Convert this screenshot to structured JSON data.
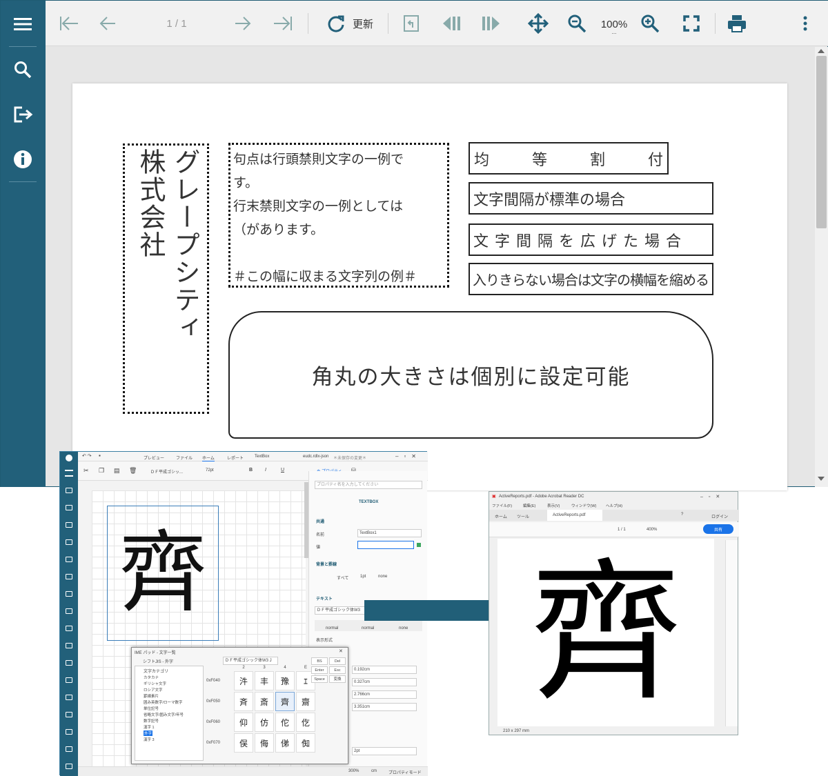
{
  "viewer": {
    "toolbar": {
      "page_indicator": "1 / 1",
      "refresh_label": "更新",
      "zoom_level": "100%",
      "zoom_sub": "..."
    },
    "report": {
      "vertical_text_col1": "グレープシティ",
      "vertical_text_col2": "株式会社",
      "kinsoku_lines": [
        "句点は行頭禁則文字の一例で",
        "す。",
        "行末禁則文字の一例としては",
        "（があります。",
        "",
        "＃この幅に収まる文字列の例＃"
      ],
      "justify_chars": [
        "均",
        "等",
        "割",
        "付"
      ],
      "spacing_normal": "文字間隔が標準の場合",
      "spacing_wide": "文字間隔を広げた場合",
      "shrink": "入りきらない場合は文字の横幅を縮める",
      "rounded": "角丸の大きさは個別に設定可能"
    }
  },
  "designer": {
    "tabs": [
      "プレビュー",
      "ファイル",
      "ホーム",
      "レポート",
      "TextBox"
    ],
    "file_title": "eudc.rdlx-json",
    "unsaved": "＊未保存の変更＊",
    "font_select": "ＤＦ平成ゴシッ...",
    "font_size": "72pt",
    "format_buttons": [
      "B",
      "I",
      "U"
    ],
    "props_tab": "プロパティ",
    "props_search_placeholder": "プロパティ名を入力してください",
    "section_textbox": "TEXTBOX",
    "section_common": "共通",
    "name_label": "名前",
    "name_value": "TextBox1",
    "value_label": "値",
    "value_value": "",
    "section_bg": "背景と罫線",
    "border_labels": [
      "すべて",
      "1pt",
      "none"
    ],
    "section_text": "テキスト",
    "text_font": "ＤＦ平成ゴシック体W3",
    "text_style_labels": [
      "normal",
      "normal",
      "none"
    ],
    "display_format_label": "表示形式",
    "measures": [
      "0.192cm",
      "0.327cm",
      "2.766cm",
      "3.351cm"
    ],
    "border_width": "2pt",
    "canvas_glyph": "齊",
    "status": {
      "zoom": "300%",
      "unit": "cm",
      "mode": "プロパティモード"
    },
    "ime": {
      "title": "IME パッド - 文字一覧",
      "charset": "シフトJIS - 外字",
      "font": "ＤＦ平成ゴシック体W3 J",
      "category_header": "文字カテゴリ",
      "categories": [
        "カタカナ",
        "ギリシャ文字",
        "ロシア文字",
        "罫線素片",
        "囲み英数字/ローマ数字",
        "単位記号",
        "省略文字/囲み文字/年号",
        "数字記号",
        "漢字 1",
        "外字",
        "漢字 3"
      ],
      "column_heads": [
        "2",
        "3",
        "4",
        "E"
      ],
      "row_codes": [
        "0xF040",
        "0xF050",
        "0xF060",
        "0xF070"
      ],
      "grid": [
        [
          "汼",
          "丰",
          "豫",
          "ｴ"
        ],
        [
          "斉",
          "斎",
          "齊",
          "齋"
        ],
        [
          "仰",
          "仿",
          "佗",
          "仡"
        ],
        [
          "俣",
          "侮",
          "俤",
          "倁"
        ]
      ],
      "keys": [
        "BS",
        "Del",
        "Enter",
        "Esc",
        "Space",
        "変換"
      ],
      "side_tabs": [
        "部",
        "画",
        "部"
      ]
    }
  },
  "acrobat": {
    "title": "ActiveReports.pdf - Adobe Acrobat Reader DC",
    "menu": [
      "ファイル(F)",
      "編集(E)",
      "表示(V)",
      "ウィンドウ(W)",
      "ヘルプ(H)"
    ],
    "tabs": [
      "ホーム",
      "ツール"
    ],
    "doc_tab": "ActiveReports.pdf",
    "login": "ログイン",
    "page": "1 / 1",
    "zoom": "400%",
    "share": "共有",
    "page_size": "210 x 297 mm",
    "glyph": "齊"
  },
  "colors": {
    "sidebar": "#22607a",
    "accent": "#1a73e8",
    "arrow": "#215f78"
  }
}
